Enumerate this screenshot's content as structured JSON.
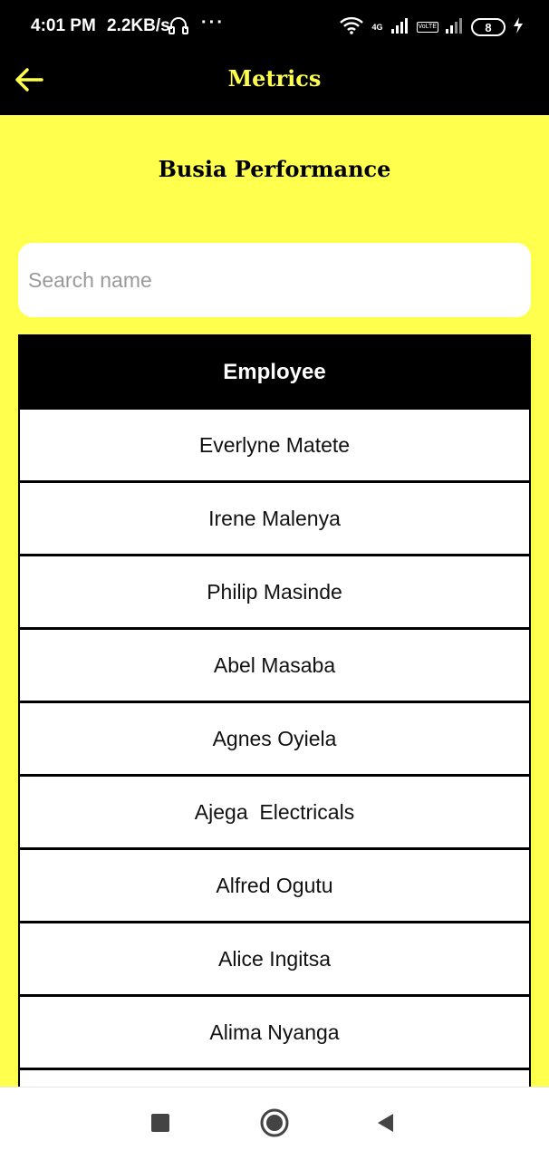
{
  "status_bar": {
    "time": "4:01 PM",
    "speed": "2.2KB/s",
    "more": "···",
    "network_tag": "4G",
    "volte_tag": "VoLTE",
    "battery": "8"
  },
  "app_bar": {
    "title": "Metrics",
    "back_icon": "arrow-left-icon"
  },
  "page": {
    "heading": "Busia Performance"
  },
  "search": {
    "placeholder": "Search name",
    "value": ""
  },
  "table": {
    "header": "Employee",
    "rows": [
      "Everlyne Matete",
      "Irene Malenya",
      "Philip Masinde",
      "Abel Masaba",
      "Agnes Oyiela",
      "Ajega  Electricals",
      "Alfred Ogutu",
      "Alice Ingitsa",
      "Alima Nyanga",
      ""
    ]
  },
  "nav_bar": {
    "recents_icon": "square-icon",
    "home_icon": "circle-icon",
    "back_icon": "triangle-back-icon"
  },
  "colors": {
    "accent_yellow": "#ffff4d",
    "bar_black": "#000000"
  }
}
